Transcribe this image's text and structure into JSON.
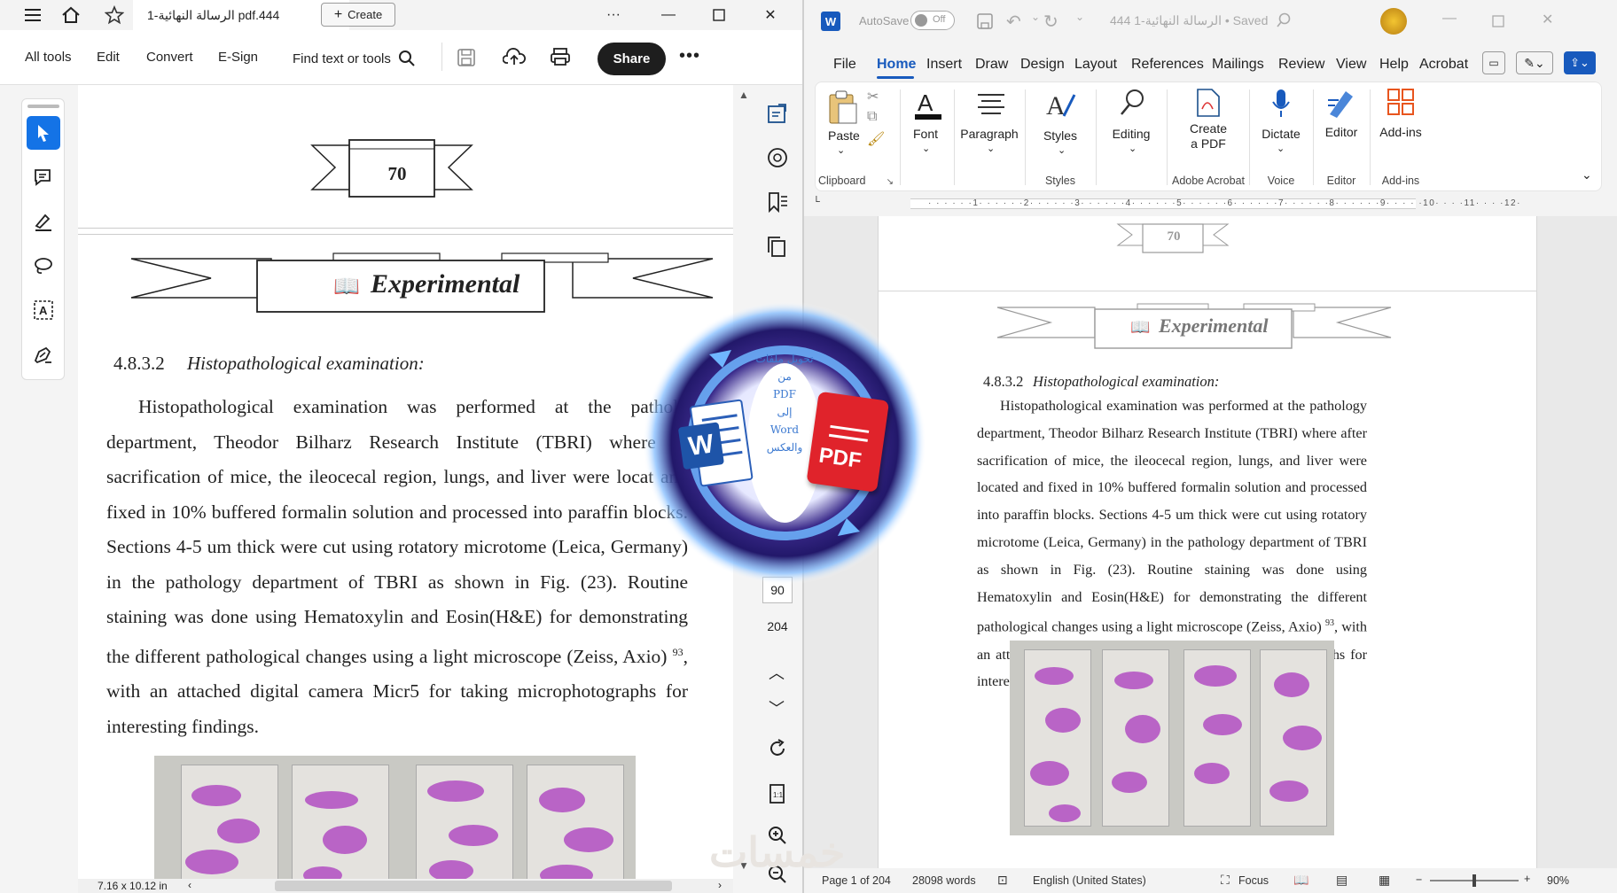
{
  "acrobat": {
    "tab_title": "الرسالة النهائية-1 pdf.444",
    "create_label": "Create",
    "menu": [
      "All tools",
      "Edit",
      "Convert",
      "E-Sign"
    ],
    "find_label": "Find text or tools",
    "share_label": "Share",
    "page_number": "70",
    "banner_title": "Experimental",
    "section_number": "4.8.3.2",
    "section_title": "Histopathological examination:",
    "paragraph": "Histopathological examination was performed at the patholo department, Theodor Bilharz Research Institute (TBRI) where af sacrification of mice, the ileocecal region, lungs, and liver were locat and fixed in 10% buffered formalin solution and processed into paraffin blocks. Sections 4-5 um thick were cut using rotatory microtome (Leica, Germany) in the pathology department of TBRI as shown in Fig. (23). Routine staining was done using Hematoxylin and Eosin(H&E) for demonstrating the different pathological changes using a light microscope (Zeiss, Axio)",
    "paragraph_ref": "93",
    "paragraph_tail": ", with an attached digital camera Micr5 for taking microphotographs for interesting findings.",
    "current_page": "90",
    "total_pages": "204",
    "page_size": "7.16 x 10.12 in"
  },
  "word": {
    "autosave_label": "AutoSave",
    "autosave_state": "Off",
    "doc_title": "444 الرسالة النهائية-1 • Saved",
    "tabs": [
      "File",
      "Home",
      "Insert",
      "Draw",
      "Design",
      "Layout",
      "References",
      "Mailings",
      "Review",
      "View",
      "Help",
      "Acrobat"
    ],
    "active_tab": "Home",
    "ribbon": {
      "paste": "Paste",
      "clipboard": "Clipboard",
      "font": "Font",
      "paragraph": "Paragraph",
      "styles": "Styles",
      "styles_group": "Styles",
      "editing": "Editing",
      "create_pdf_1": "Create",
      "create_pdf_2": "a PDF",
      "adobe_group": "Adobe Acrobat",
      "dictate": "Dictate",
      "voice_group": "Voice",
      "editor": "Editor",
      "editor_group": "Editor",
      "addins": "Add-ins",
      "addins_group": "Add-ins"
    },
    "page_number": "70",
    "banner_title": "Experimental",
    "section_number": "4.8.3.2",
    "section_title": "Histopathological examination:",
    "paragraph": "Histopathological examination was performed at the pathology department, Theodor Bilharz Research Institute (TBRI) where after sacrification of mice, the ileocecal region, lungs, and liver were located and fixed in 10% buffered formalin solution and processed into paraffin blocks. Sections 4-5 um thick were cut using rotatory microtome (Leica, Germany) in the pathology department of TBRI as shown in Fig. (23). Routine staining was done using Hematoxylin and Eosin(H&E) for demonstrating the different pathological changes using a light microscope (Zeiss, Axio)",
    "paragraph_ref": "93",
    "paragraph_tail": ", with an attached digital camera Micr5 for taking microphotographs for interesting findings.",
    "status": {
      "page": "Page 1 of 204",
      "words": "28098 words",
      "language": "English (United States)",
      "focus": "Focus",
      "zoom": "90%"
    }
  },
  "overlay": {
    "word_letter": "W",
    "pdf_label": "PDF",
    "arabic_caption_1": "تحويل ملفات",
    "arabic_caption_2": "من",
    "arabic_caption_3": "PDF",
    "arabic_caption_4": "إلى",
    "arabic_caption_5": "Word",
    "arabic_caption_6": "والعكس"
  },
  "watermark": "خمسات",
  "colors": {
    "acrobat_select": "#1473e6",
    "word_accent": "#185abd",
    "pdf_red": "#e0232b",
    "slide_purple": "#b24fc2",
    "overlay_navy": "#2b1d6e"
  }
}
